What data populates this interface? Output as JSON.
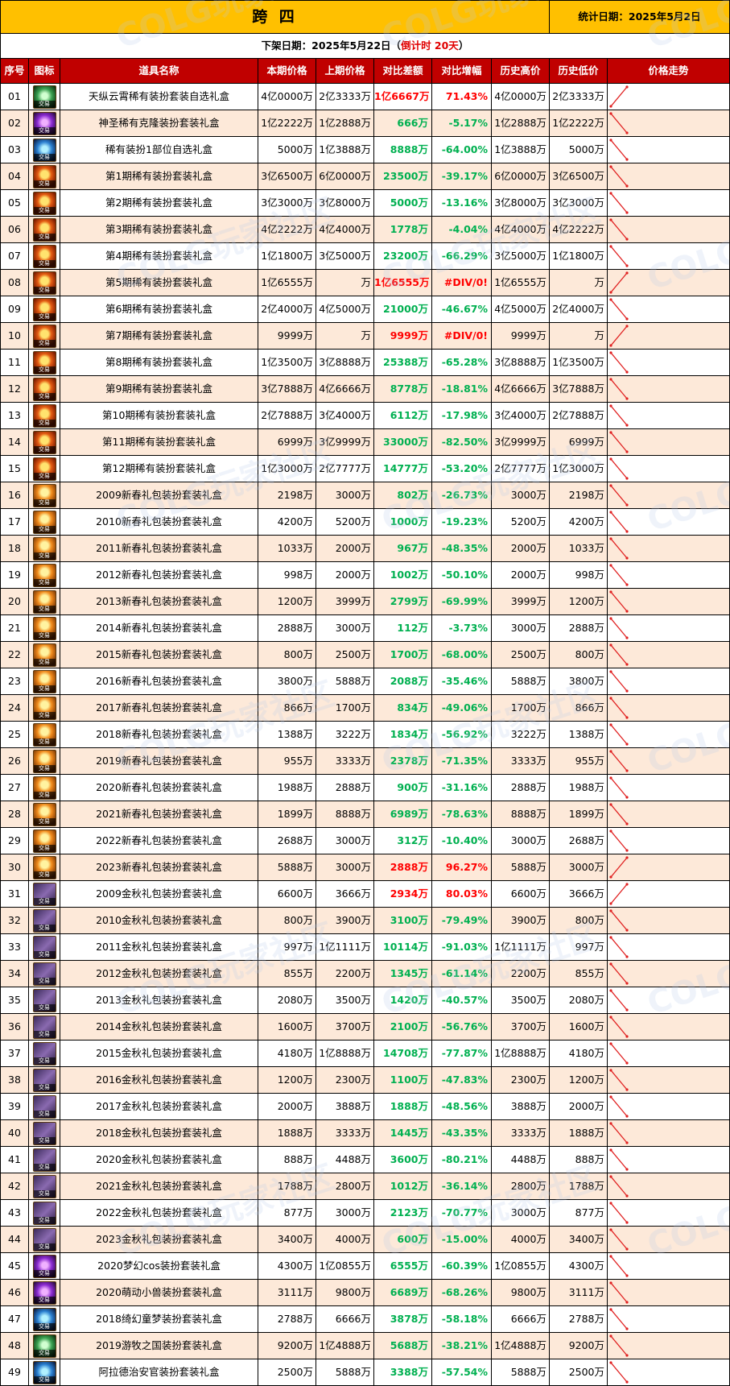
{
  "header": {
    "title": "跨 四",
    "stat_date": "统计日期：2025年5月2日",
    "delist_prefix": "下架日期：2025年5月22日（",
    "delist_countdown": "倒计时 20天",
    "delist_suffix": "）"
  },
  "columns": [
    "序号",
    "图标",
    "道具名称",
    "本期价格",
    "上期价格",
    "对比差额",
    "对比增幅",
    "历史高价",
    "历史低价",
    "价格走势"
  ],
  "icon_tag": "交易",
  "watermark_text": "COLG玩家社区",
  "rows": [
    {
      "idx": "01",
      "icon": "green",
      "name": "天纵云霄稀有装扮套装自选礼盒",
      "cur": "4亿0000万",
      "prev": "2亿3333万",
      "diff": "1亿6667万",
      "pct": "71.43%",
      "dir": "up",
      "high": "4亿0000万",
      "low": "2亿3333万"
    },
    {
      "idx": "02",
      "icon": "purple",
      "name": "神圣稀有克隆装扮套装礼盒",
      "cur": "1亿2222万",
      "prev": "1亿2888万",
      "diff": "666万",
      "pct": "-5.17%",
      "dir": "down",
      "high": "1亿2888万",
      "low": "1亿2222万"
    },
    {
      "idx": "03",
      "icon": "rare",
      "name": "稀有装扮1部位自选礼盒",
      "cur": "5000万",
      "prev": "1亿3888万",
      "diff": "8888万",
      "pct": "-64.00%",
      "dir": "down",
      "high": "1亿3888万",
      "low": "5000万"
    },
    {
      "idx": "04",
      "icon": "gift",
      "name": "第1期稀有装扮套装礼盒",
      "cur": "3亿6500万",
      "prev": "6亿0000万",
      "diff": "23500万",
      "pct": "-39.17%",
      "dir": "down",
      "high": "6亿0000万",
      "low": "3亿6500万"
    },
    {
      "idx": "05",
      "icon": "gift",
      "name": "第2期稀有装扮套装礼盒",
      "cur": "3亿3000万",
      "prev": "3亿8000万",
      "diff": "5000万",
      "pct": "-13.16%",
      "dir": "down",
      "high": "3亿8000万",
      "low": "3亿3000万"
    },
    {
      "idx": "06",
      "icon": "gift",
      "name": "第3期稀有装扮套装礼盒",
      "cur": "4亿2222万",
      "prev": "4亿4000万",
      "diff": "1778万",
      "pct": "-4.04%",
      "dir": "down",
      "high": "4亿4000万",
      "low": "4亿2222万"
    },
    {
      "idx": "07",
      "icon": "gift",
      "name": "第4期稀有装扮套装礼盒",
      "cur": "1亿1800万",
      "prev": "3亿5000万",
      "diff": "23200万",
      "pct": "-66.29%",
      "dir": "down",
      "high": "3亿5000万",
      "low": "1亿1800万"
    },
    {
      "idx": "08",
      "icon": "gift",
      "name": "第5期稀有装扮套装礼盒",
      "cur": "1亿6555万",
      "prev": "万",
      "diff": "1亿6555万",
      "pct": "#DIV/0!",
      "dir": "up",
      "high": "1亿6555万",
      "low": "万"
    },
    {
      "idx": "09",
      "icon": "gift",
      "name": "第6期稀有装扮套装礼盒",
      "cur": "2亿4000万",
      "prev": "4亿5000万",
      "diff": "21000万",
      "pct": "-46.67%",
      "dir": "down",
      "high": "4亿5000万",
      "low": "2亿4000万"
    },
    {
      "idx": "10",
      "icon": "gift",
      "name": "第7期稀有装扮套装礼盒",
      "cur": "9999万",
      "prev": "万",
      "diff": "9999万",
      "pct": "#DIV/0!",
      "dir": "up",
      "high": "9999万",
      "low": "万"
    },
    {
      "idx": "11",
      "icon": "gift",
      "name": "第8期稀有装扮套装礼盒",
      "cur": "1亿3500万",
      "prev": "3亿8888万",
      "diff": "25388万",
      "pct": "-65.28%",
      "dir": "down",
      "high": "3亿8888万",
      "low": "1亿3500万"
    },
    {
      "idx": "12",
      "icon": "gift",
      "name": "第9期稀有装扮套装礼盒",
      "cur": "3亿7888万",
      "prev": "4亿6666万",
      "diff": "8778万",
      "pct": "-18.81%",
      "dir": "down",
      "high": "4亿6666万",
      "low": "3亿7888万"
    },
    {
      "idx": "13",
      "icon": "gift",
      "name": "第10期稀有装扮套装礼盒",
      "cur": "2亿7888万",
      "prev": "3亿4000万",
      "diff": "6112万",
      "pct": "-17.98%",
      "dir": "down",
      "high": "3亿4000万",
      "low": "2亿7888万"
    },
    {
      "idx": "14",
      "icon": "gift",
      "name": "第11期稀有装扮套装礼盒",
      "cur": "6999万",
      "prev": "3亿9999万",
      "diff": "33000万",
      "pct": "-82.50%",
      "dir": "down",
      "high": "3亿9999万",
      "low": "6999万"
    },
    {
      "idx": "15",
      "icon": "gift",
      "name": "第12期稀有装扮套装礼盒",
      "cur": "1亿3000万",
      "prev": "2亿7777万",
      "diff": "14777万",
      "pct": "-53.20%",
      "dir": "down",
      "high": "2亿7777万",
      "low": "1亿3000万"
    },
    {
      "idx": "16",
      "icon": "newyear",
      "name": "2009新春礼包装扮套装礼盒",
      "cur": "2198万",
      "prev": "3000万",
      "diff": "802万",
      "pct": "-26.73%",
      "dir": "down",
      "high": "3000万",
      "low": "2198万"
    },
    {
      "idx": "17",
      "icon": "newyear",
      "name": "2010新春礼包装扮套装礼盒",
      "cur": "4200万",
      "prev": "5200万",
      "diff": "1000万",
      "pct": "-19.23%",
      "dir": "down",
      "high": "5200万",
      "low": "4200万"
    },
    {
      "idx": "18",
      "icon": "newyear",
      "name": "2011新春礼包装扮套装礼盒",
      "cur": "1033万",
      "prev": "2000万",
      "diff": "967万",
      "pct": "-48.35%",
      "dir": "down",
      "high": "2000万",
      "low": "1033万"
    },
    {
      "idx": "19",
      "icon": "newyear",
      "name": "2012新春礼包装扮套装礼盒",
      "cur": "998万",
      "prev": "2000万",
      "diff": "1002万",
      "pct": "-50.10%",
      "dir": "down",
      "high": "2000万",
      "low": "998万"
    },
    {
      "idx": "20",
      "icon": "newyear",
      "name": "2013新春礼包装扮套装礼盒",
      "cur": "1200万",
      "prev": "3999万",
      "diff": "2799万",
      "pct": "-69.99%",
      "dir": "down",
      "high": "3999万",
      "low": "1200万"
    },
    {
      "idx": "21",
      "icon": "newyear",
      "name": "2014新春礼包装扮套装礼盒",
      "cur": "2888万",
      "prev": "3000万",
      "diff": "112万",
      "pct": "-3.73%",
      "dir": "down",
      "high": "3000万",
      "low": "2888万"
    },
    {
      "idx": "22",
      "icon": "newyear",
      "name": "2015新春礼包装扮套装礼盒",
      "cur": "800万",
      "prev": "2500万",
      "diff": "1700万",
      "pct": "-68.00%",
      "dir": "down",
      "high": "2500万",
      "low": "800万"
    },
    {
      "idx": "23",
      "icon": "newyear",
      "name": "2016新春礼包装扮套装礼盒",
      "cur": "3800万",
      "prev": "5888万",
      "diff": "2088万",
      "pct": "-35.46%",
      "dir": "down",
      "high": "5888万",
      "low": "3800万"
    },
    {
      "idx": "24",
      "icon": "newyear",
      "name": "2017新春礼包装扮套装礼盒",
      "cur": "866万",
      "prev": "1700万",
      "diff": "834万",
      "pct": "-49.06%",
      "dir": "down",
      "high": "1700万",
      "low": "866万"
    },
    {
      "idx": "25",
      "icon": "newyear",
      "name": "2018新春礼包装扮套装礼盒",
      "cur": "1388万",
      "prev": "3222万",
      "diff": "1834万",
      "pct": "-56.92%",
      "dir": "down",
      "high": "3222万",
      "low": "1388万"
    },
    {
      "idx": "26",
      "icon": "newyear",
      "name": "2019新春礼包装扮套装礼盒",
      "cur": "955万",
      "prev": "3333万",
      "diff": "2378万",
      "pct": "-71.35%",
      "dir": "down",
      "high": "3333万",
      "low": "955万"
    },
    {
      "idx": "27",
      "icon": "newyear",
      "name": "2020新春礼包装扮套装礼盒",
      "cur": "1988万",
      "prev": "2888万",
      "diff": "900万",
      "pct": "-31.16%",
      "dir": "down",
      "high": "2888万",
      "low": "1988万"
    },
    {
      "idx": "28",
      "icon": "newyear",
      "name": "2021新春礼包装扮套装礼盒",
      "cur": "1899万",
      "prev": "8888万",
      "diff": "6989万",
      "pct": "-78.63%",
      "dir": "down",
      "high": "8888万",
      "low": "1899万"
    },
    {
      "idx": "29",
      "icon": "newyear",
      "name": "2022新春礼包装扮套装礼盒",
      "cur": "2688万",
      "prev": "3000万",
      "diff": "312万",
      "pct": "-10.40%",
      "dir": "down",
      "high": "3000万",
      "low": "2688万"
    },
    {
      "idx": "30",
      "icon": "newyear",
      "name": "2023新春礼包装扮套装礼盒",
      "cur": "5888万",
      "prev": "3000万",
      "diff": "2888万",
      "pct": "96.27%",
      "dir": "up",
      "high": "5888万",
      "low": "3000万"
    },
    {
      "idx": "31",
      "icon": "autumn",
      "name": "2009金秋礼包装扮套装礼盒",
      "cur": "6600万",
      "prev": "3666万",
      "diff": "2934万",
      "pct": "80.03%",
      "dir": "up",
      "high": "6600万",
      "low": "3666万"
    },
    {
      "idx": "32",
      "icon": "autumn",
      "name": "2010金秋礼包装扮套装礼盒",
      "cur": "800万",
      "prev": "3900万",
      "diff": "3100万",
      "pct": "-79.49%",
      "dir": "down",
      "high": "3900万",
      "low": "800万"
    },
    {
      "idx": "33",
      "icon": "autumn",
      "name": "2011金秋礼包装扮套装礼盒",
      "cur": "997万",
      "prev": "1亿1111万",
      "diff": "10114万",
      "pct": "-91.03%",
      "dir": "down",
      "high": "1亿1111万",
      "low": "997万"
    },
    {
      "idx": "34",
      "icon": "autumn",
      "name": "2012金秋礼包装扮套装礼盒",
      "cur": "855万",
      "prev": "2200万",
      "diff": "1345万",
      "pct": "-61.14%",
      "dir": "down",
      "high": "2200万",
      "low": "855万"
    },
    {
      "idx": "35",
      "icon": "autumn",
      "name": "2013金秋礼包装扮套装礼盒",
      "cur": "2080万",
      "prev": "3500万",
      "diff": "1420万",
      "pct": "-40.57%",
      "dir": "down",
      "high": "3500万",
      "low": "2080万"
    },
    {
      "idx": "36",
      "icon": "autumn",
      "name": "2014金秋礼包装扮套装礼盒",
      "cur": "1600万",
      "prev": "3700万",
      "diff": "2100万",
      "pct": "-56.76%",
      "dir": "down",
      "high": "3700万",
      "low": "1600万"
    },
    {
      "idx": "37",
      "icon": "autumn",
      "name": "2015金秋礼包装扮套装礼盒",
      "cur": "4180万",
      "prev": "1亿8888万",
      "diff": "14708万",
      "pct": "-77.87%",
      "dir": "down",
      "high": "1亿8888万",
      "low": "4180万"
    },
    {
      "idx": "38",
      "icon": "autumn",
      "name": "2016金秋礼包装扮套装礼盒",
      "cur": "1200万",
      "prev": "2300万",
      "diff": "1100万",
      "pct": "-47.83%",
      "dir": "down",
      "high": "2300万",
      "low": "1200万"
    },
    {
      "idx": "39",
      "icon": "autumn",
      "name": "2017金秋礼包装扮套装礼盒",
      "cur": "2000万",
      "prev": "3888万",
      "diff": "1888万",
      "pct": "-48.56%",
      "dir": "down",
      "high": "3888万",
      "low": "2000万"
    },
    {
      "idx": "40",
      "icon": "autumn",
      "name": "2018金秋礼包装扮套装礼盒",
      "cur": "1888万",
      "prev": "3333万",
      "diff": "1445万",
      "pct": "-43.35%",
      "dir": "down",
      "high": "3333万",
      "low": "1888万"
    },
    {
      "idx": "41",
      "icon": "autumn",
      "name": "2020金秋礼包装扮套装礼盒",
      "cur": "888万",
      "prev": "4488万",
      "diff": "3600万",
      "pct": "-80.21%",
      "dir": "down",
      "high": "4488万",
      "low": "888万"
    },
    {
      "idx": "42",
      "icon": "autumn",
      "name": "2021金秋礼包装扮套装礼盒",
      "cur": "1788万",
      "prev": "2800万",
      "diff": "1012万",
      "pct": "-36.14%",
      "dir": "down",
      "high": "2800万",
      "low": "1788万"
    },
    {
      "idx": "43",
      "icon": "autumn",
      "name": "2022金秋礼包装扮套装礼盒",
      "cur": "877万",
      "prev": "3000万",
      "diff": "2123万",
      "pct": "-70.77%",
      "dir": "down",
      "high": "3000万",
      "low": "877万"
    },
    {
      "idx": "44",
      "icon": "autumn",
      "name": "2023金秋礼包装扮套装礼盒",
      "cur": "3400万",
      "prev": "4000万",
      "diff": "600万",
      "pct": "-15.00%",
      "dir": "down",
      "high": "4000万",
      "low": "3400万"
    },
    {
      "idx": "45",
      "icon": "purple",
      "name": "2020梦幻cos装扮套装礼盒",
      "cur": "4300万",
      "prev": "1亿0855万",
      "diff": "6555万",
      "pct": "-60.39%",
      "dir": "down",
      "high": "1亿0855万",
      "low": "4300万"
    },
    {
      "idx": "46",
      "icon": "purple",
      "name": "2020萌动小兽装扮套装礼盒",
      "cur": "3111万",
      "prev": "9800万",
      "diff": "6689万",
      "pct": "-68.26%",
      "dir": "down",
      "high": "9800万",
      "low": "3111万"
    },
    {
      "idx": "47",
      "icon": "rare",
      "name": "2018绮幻童梦装扮套装礼盒",
      "cur": "2788万",
      "prev": "6666万",
      "diff": "3878万",
      "pct": "-58.18%",
      "dir": "down",
      "high": "6666万",
      "low": "2788万"
    },
    {
      "idx": "48",
      "icon": "green",
      "name": "2019游牧之国装扮套装礼盒",
      "cur": "9200万",
      "prev": "1亿4888万",
      "diff": "5688万",
      "pct": "-38.21%",
      "dir": "down",
      "high": "1亿4888万",
      "low": "9200万"
    },
    {
      "idx": "49",
      "icon": "rare",
      "name": "阿拉德治安官装扮套装礼盒",
      "cur": "2500万",
      "prev": "5888万",
      "diff": "3388万",
      "pct": "-57.54%",
      "dir": "down",
      "high": "5888万",
      "low": "2500万"
    }
  ]
}
